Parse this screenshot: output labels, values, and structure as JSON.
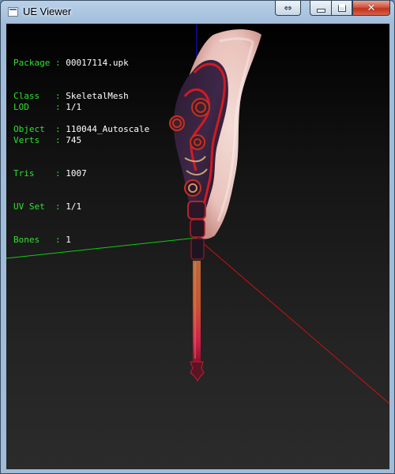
{
  "window": {
    "title": "UE Viewer"
  },
  "titlebar_buttons": {
    "resize_icon": "double-arrow-icon",
    "minimize_icon": "minimize-icon",
    "maximize_icon": "maximize-icon",
    "close_icon": "close-icon",
    "close_color": "#c0321b"
  },
  "object_info": [
    {
      "key": "Package",
      "sep": " : ",
      "value": "00017114.upk"
    },
    {
      "key": "Class  ",
      "sep": " : ",
      "value": "SkeletalMesh"
    },
    {
      "key": "Object ",
      "sep": " : ",
      "value": "110044_Autoscale"
    }
  ],
  "mesh_info": [
    {
      "key": "LOD    ",
      "sep": " : ",
      "value": "1/1"
    },
    {
      "key": "Verts  ",
      "sep": " : ",
      "value": "745"
    },
    {
      "key": "Tris   ",
      "sep": " : ",
      "value": "1007"
    },
    {
      "key": "UV Set ",
      "sep": " : ",
      "value": "1/1"
    },
    {
      "key": "Bones  ",
      "sep": " : ",
      "value": "1"
    }
  ],
  "colors": {
    "label": "#2fe02f",
    "value": "#ffffff",
    "axis_x": "#cc1010",
    "axis_y": "#10cc10",
    "axis_z": "#1010ee"
  },
  "model": {
    "name_icon": "axe-mesh"
  }
}
